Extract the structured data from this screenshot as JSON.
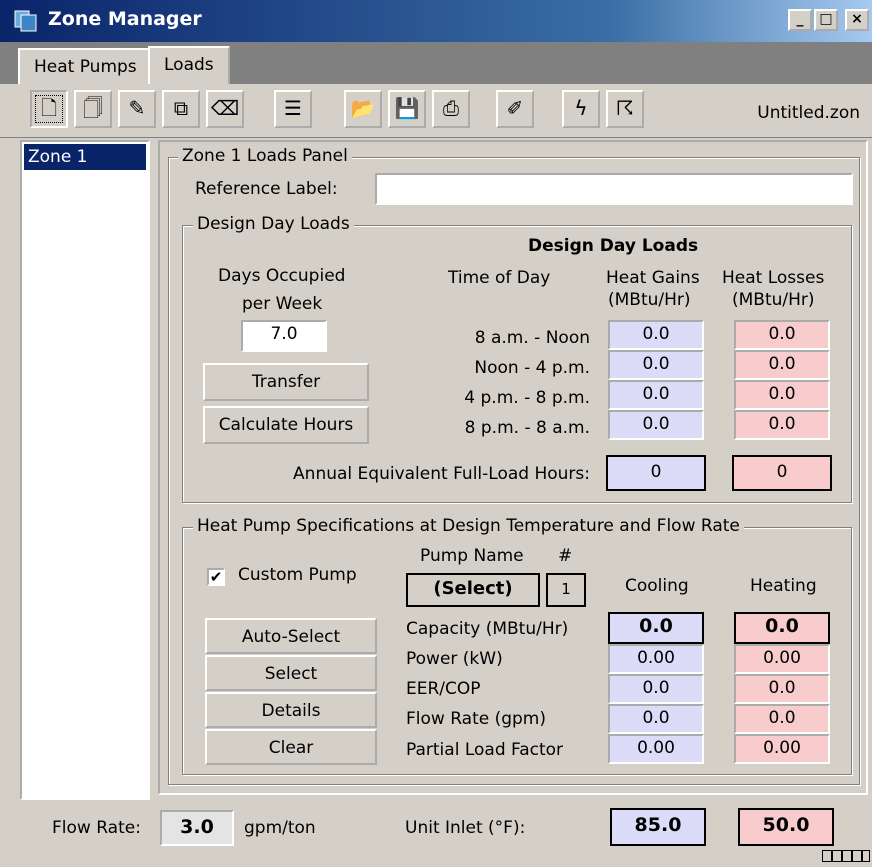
{
  "window": {
    "title": "Zone Manager",
    "minimize": "_",
    "maximize": "□",
    "close": "×"
  },
  "tabs": [
    {
      "label": "Heat Pumps"
    },
    {
      "label": "Loads"
    }
  ],
  "toolbar": {
    "filename": "Untitled.zon",
    "icons": [
      "new-doc-icon",
      "copy-doc-icon",
      "edit-doc-icon",
      "duplicate-doc-icon",
      "erase-icon",
      "notes-icon",
      "open-folder-icon",
      "save-icon",
      "print-icon",
      "tag-icon",
      "calc-icon",
      "calc-all-icon"
    ]
  },
  "zones": [
    {
      "label": "Zone 1"
    }
  ],
  "panel": {
    "title": "Zone 1 Loads Panel",
    "reference_label": "Reference Label:",
    "reference_value": "",
    "design_day": {
      "group_title": "Design Day Loads",
      "heading": "Design Day Loads",
      "days_label_1": "Days Occupied",
      "days_label_2": "per Week",
      "days_value": "7.0",
      "transfer_button": "Transfer",
      "calc_hours_button": "Calculate Hours",
      "time_of_day_header": "Time of Day",
      "gains_header_1": "Heat Gains",
      "gains_header_2": "(MBtu/Hr)",
      "losses_header_1": "Heat Losses",
      "losses_header_2": "(MBtu/Hr)",
      "rows": [
        {
          "time": "8 a.m. - Noon",
          "gain": "0.0",
          "loss": "0.0"
        },
        {
          "time": "Noon - 4 p.m.",
          "gain": "0.0",
          "loss": "0.0"
        },
        {
          "time": "4 p.m. - 8 p.m.",
          "gain": "0.0",
          "loss": "0.0"
        },
        {
          "time": "8 p.m. - 8 a.m.",
          "gain": "0.0",
          "loss": "0.0"
        }
      ],
      "annual_label": "Annual Equivalent Full-Load Hours:",
      "annual_gain": "0",
      "annual_loss": "0"
    },
    "pump_specs": {
      "group_title": "Heat Pump Specifications at Design Temperature and Flow Rate",
      "custom_pump_label": "Custom Pump",
      "custom_pump_checked": "✔",
      "pump_name_header": "Pump Name",
      "number_header": "#",
      "select_pump_button": "(Select)",
      "pump_number": "1",
      "cooling_header": "Cooling",
      "heating_header": "Heating",
      "buttons": {
        "auto_select": "Auto-Select",
        "select": "Select",
        "details": "Details",
        "clear": "Clear"
      },
      "rows": [
        {
          "label": "Capacity (MBtu/Hr)",
          "cooling": "0.0",
          "heating": "0.0"
        },
        {
          "label": "Power (kW)",
          "cooling": "0.00",
          "heating": "0.00"
        },
        {
          "label": "EER/COP",
          "cooling": "0.0",
          "heating": "0.0"
        },
        {
          "label": "Flow Rate (gpm)",
          "cooling": "0.0",
          "heating": "0.0"
        },
        {
          "label": "Partial Load Factor",
          "cooling": "0.00",
          "heating": "0.00"
        }
      ]
    }
  },
  "status": {
    "flow_rate_label": "Flow Rate:",
    "flow_rate_value": "3.0",
    "flow_rate_unit": "gpm/ton",
    "unit_inlet_label": "Unit Inlet (°F):",
    "cooling_inlet": "85.0",
    "heating_inlet": "50.0"
  },
  "colors": {
    "cooling": "#dcdcf8",
    "heating": "#f8cccc",
    "title_bar": "#0a246a"
  }
}
